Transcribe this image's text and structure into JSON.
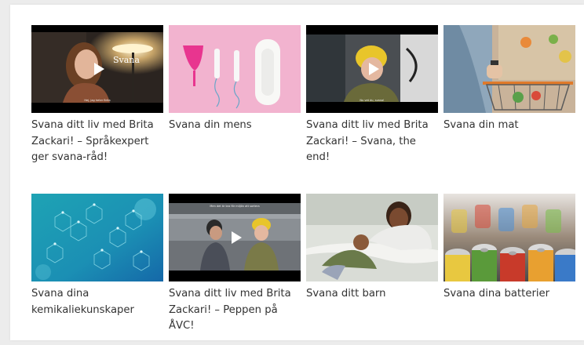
{
  "cards": [
    {
      "title": "Svana ditt liv med Brita Zackari! – Språkexpert ger svana-råd!",
      "thumb_icon": "woman-speaking-thumbnail",
      "caption": "Hej, jag heter Brita",
      "logo_text": "Svana",
      "is_video": true
    },
    {
      "title": "Svana din mens",
      "thumb_icon": "menstrual-products-thumbnail",
      "is_video": false
    },
    {
      "title": "Svana ditt liv med Brita Zackari! – Svana, the end!",
      "thumb_icon": "woman-yellow-beanie-thumbnail",
      "caption": "Nu vet du, svana!",
      "is_video": true
    },
    {
      "title": "Svana din mat",
      "thumb_icon": "grocery-cart-thumbnail",
      "is_video": false
    },
    {
      "title": "Svana dina kemikaliekunskaper",
      "thumb_icon": "molecule-pattern-thumbnail",
      "is_video": false
    },
    {
      "title": "Svana ditt liv med Brita Zackari! – Peppen på ÅVC!",
      "thumb_icon": "two-women-recycling-thumbnail",
      "caption": "Men det är bra för miljön att sortera",
      "is_video": true
    },
    {
      "title": "Svana ditt barn",
      "thumb_icon": "mother-and-baby-thumbnail",
      "is_video": false
    },
    {
      "title": "Svana dina batterier",
      "thumb_icon": "batteries-thumbnail",
      "is_video": false
    }
  ],
  "colors": {
    "page_bg": "#ececec",
    "card_bg": "#ffffff",
    "text": "#333333",
    "video_bar": "#000000"
  }
}
